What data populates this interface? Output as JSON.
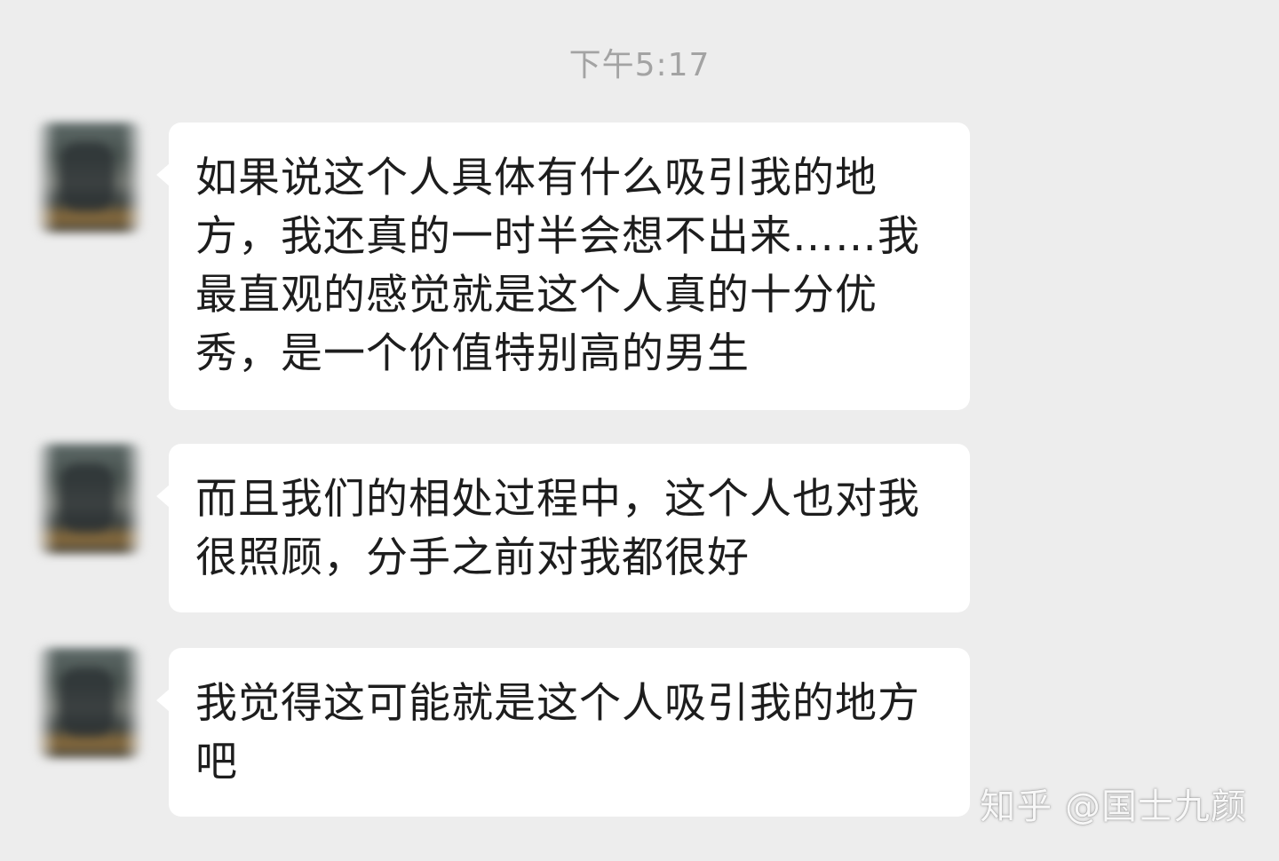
{
  "chat": {
    "timestamp": "下午5:17",
    "messages": [
      {
        "text": "如果说这个人具体有什么吸引我的地方，我还真的一时半会想不出来……我最直观的感觉就是这个人真的十分优秀，是一个价值特别高的男生"
      },
      {
        "text": "而且我们的相处过程中，这个人也对我很照顾，分手之前对我都很好"
      },
      {
        "text": "我觉得这可能就是这个人吸引我的地方吧"
      }
    ]
  },
  "watermark": {
    "text": "知乎 @国士九颜"
  },
  "colors": {
    "background": "#ededed",
    "bubble": "#ffffff",
    "timestamp": "#a3a3a3",
    "text": "#1d1d1d"
  }
}
